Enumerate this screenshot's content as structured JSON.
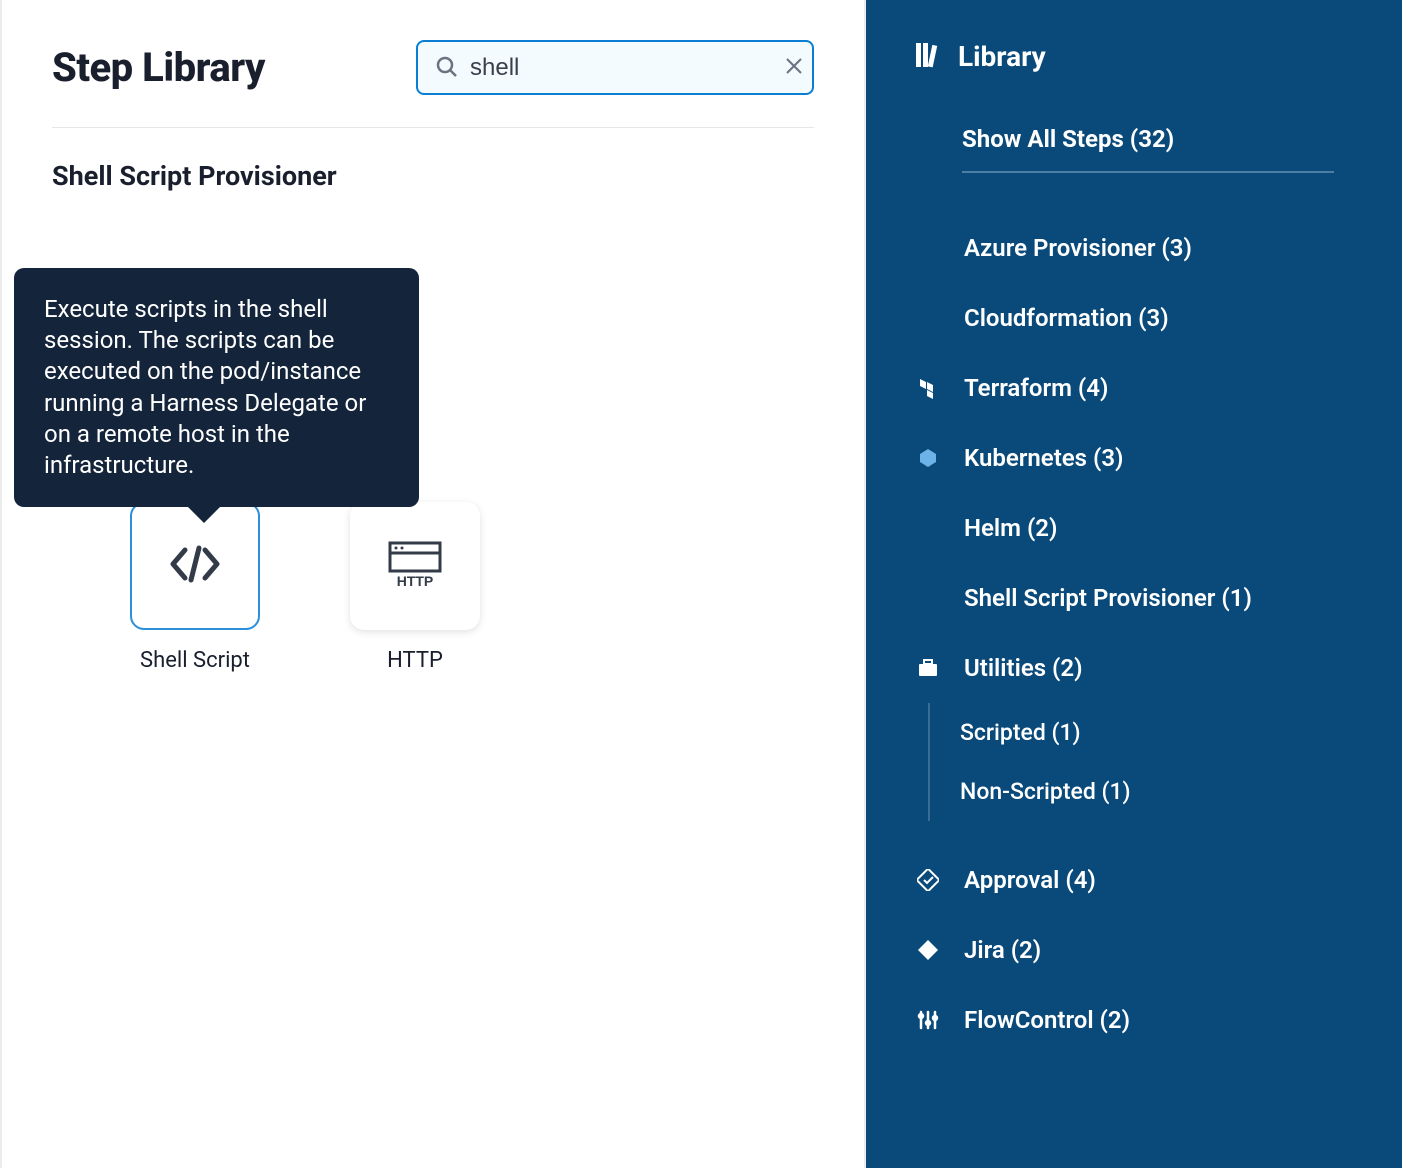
{
  "main": {
    "title": "Step Library",
    "search_value": "shell",
    "section_title": "Shell Script Provisioner",
    "tooltip_text": "Execute scripts in the shell session. The scripts can be executed on the pod/instance running a Harness Delegate or on a remote host in the infrastructure.",
    "cards": [
      {
        "label": "Shell Script",
        "icon": "code",
        "selected": true
      },
      {
        "label": "HTTP",
        "icon": "http",
        "selected": false
      }
    ]
  },
  "sidebar": {
    "title": "Library",
    "show_all_label": "Show All Steps (32)",
    "categories": [
      {
        "label": "Azure Provisioner (3)",
        "icon": null,
        "children": null
      },
      {
        "label": "Cloudformation (3)",
        "icon": null,
        "children": null
      },
      {
        "label": "Terraform (4)",
        "icon": "terraform",
        "children": null
      },
      {
        "label": "Kubernetes (3)",
        "icon": "kubernetes",
        "children": null
      },
      {
        "label": "Helm (2)",
        "icon": null,
        "children": null
      },
      {
        "label": "Shell Script Provisioner (1)",
        "icon": null,
        "children": null
      },
      {
        "label": "Utilities (2)",
        "icon": "briefcase",
        "children": [
          {
            "label": "Scripted (1)"
          },
          {
            "label": "Non-Scripted (1)"
          }
        ]
      },
      {
        "label": "Approval (4)",
        "icon": "approval",
        "spacer_before": true,
        "children": null
      },
      {
        "label": "Jira (2)",
        "icon": "jira",
        "children": null
      },
      {
        "label": "FlowControl (2)",
        "icon": "sliders",
        "children": null
      }
    ]
  }
}
